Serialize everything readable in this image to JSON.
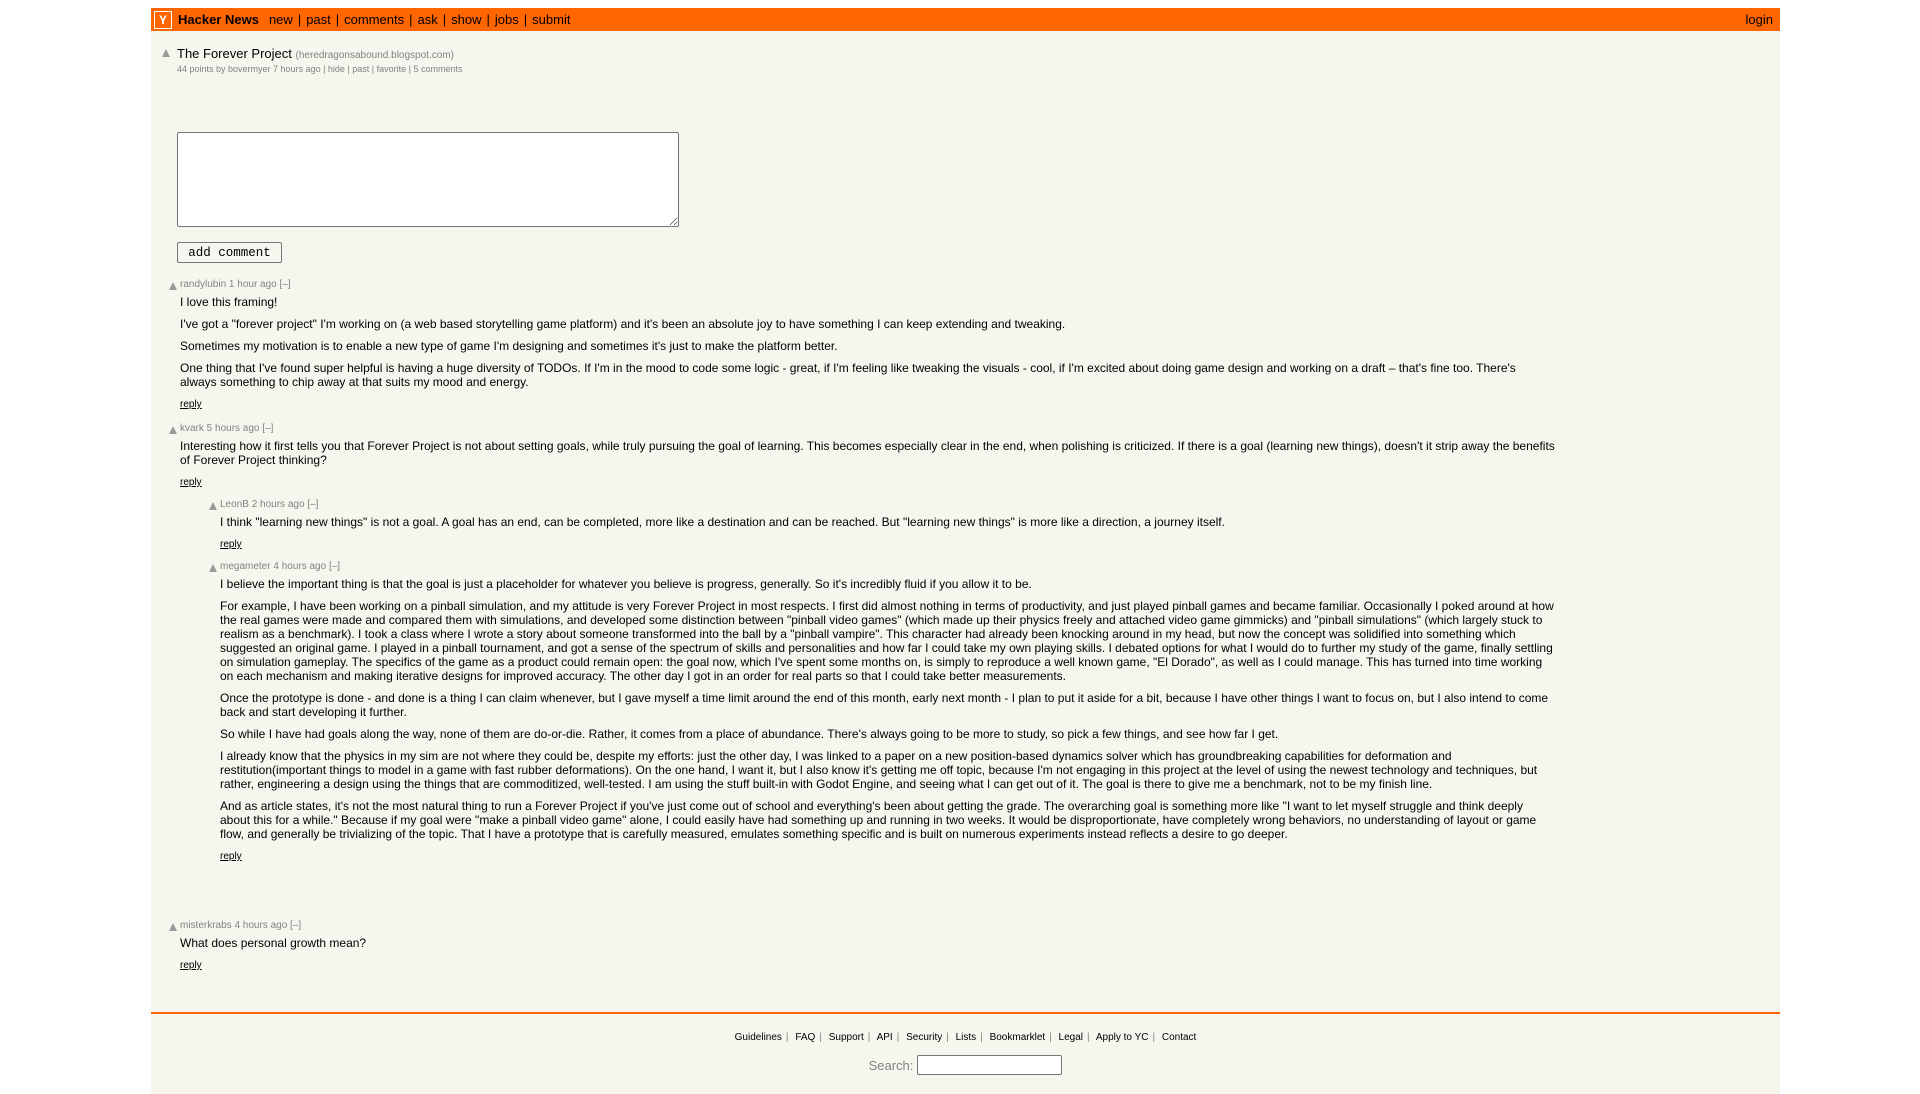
{
  "header": {
    "logo": "Y",
    "site_name": "Hacker News",
    "nav": [
      "new",
      "past",
      "comments",
      "ask",
      "show",
      "jobs",
      "submit"
    ],
    "login": "login"
  },
  "story": {
    "title": "The Forever Project",
    "site": "(heredragonsabound.blogspot.com)",
    "subtext": "44 points by bovermyer 7 hours ago | hide | past | favorite | 5 comments"
  },
  "form": {
    "button": "add comment"
  },
  "comments": [
    {
      "head": "randylubin 1 hour ago [–]",
      "paras": [
        "I love this framing!",
        "I've got a \"forever project\" I'm working on (a web based storytelling game platform) and it's been an absolute joy to have something I can keep extending and tweaking.",
        "Sometimes my motivation is to enable a new type of game I'm designing and sometimes it's just to make the platform better.",
        "One thing that I've found super helpful is having a huge diversity of TODOs. If I'm in the mood to code some logic - great, if I'm feeling like tweaking the visuals - cool, if I'm excited about doing game design and working on a draft – that's fine too. There's always something to chip away at that suits my mood and energy."
      ],
      "reply": "reply"
    },
    {
      "head": "kvark 5 hours ago [–]",
      "paras": [
        "Interesting how it first tells you that Forever Project is not about setting goals, while truly pursuing the goal of learning. This becomes especially clear in the end, when polishing is criticized. If there is a goal (learning new things), doesn't it strip away the benefits of Forever Project thinking?"
      ],
      "reply": "reply"
    },
    {
      "head": "LeonB 2 hours ago [–]",
      "paras": [
        "I think \"learning new things\" is not a goal. A goal has an end, can be completed, more like a destination and can be reached. But \"learning new things\" is more like a direction, a journey itself."
      ],
      "reply": "reply"
    },
    {
      "head": "megameter 4 hours ago [–]",
      "paras": [
        "I believe the important thing is that the goal is just a placeholder for whatever you believe is progress, generally. So it's incredibly fluid if you allow it to be.",
        "For example, I have been working on a pinball simulation, and my attitude is very Forever Project in most respects. I first did almost nothing in terms of productivity, and just played pinball games and became familiar. Occasionally I poked around at how the real games were made and compared them with simulations, and developed some distinction between \"pinball video games\" (which made up their physics freely and attached video game gimmicks) and \"pinball simulations\" (which largely stuck to realism as a benchmark). I took a class where I wrote a story about someone transformed into the ball by a \"pinball vampire\". This character had already been knocking around in my head, but now the concept was solidified into something which suggested an original game. I played in a pinball tournament, and got a sense of the spectrum of skills and personalities and how far I could take my own playing skills. I debated options for what I would do to further my study of the game, finally settling on simulation gameplay. The specifics of the game as a product could remain open: the goal now, which I've spent some months on, is simply to reproduce a well known game, \"El Dorado\", as well as I could manage. This has turned into time working on each mechanism and making iterative designs for improved accuracy. The other day I got in an order for real parts so that I could take better measurements.",
        "Once the prototype is done - and done is a thing I can claim whenever, but I gave myself a time limit around the end of this month, early next month - I plan to put it aside for a bit, because I have other things I want to focus on, but I also intend to come back and start developing it further.",
        "So while I have had goals along the way, none of them are do-or-die. Rather, it comes from a place of abundance. There's always going to be more to study, so pick a few things, and see how far I get.",
        "I already know that the physics in my sim are not where they could be, despite my efforts: just the other day, I was linked to a paper on a new position-based dynamics solver which has groundbreaking capabilities for deformation and restitution(important things to model in a game with fast rubber deformations). On the one hand, I want it, but I also know it's getting me off topic, because I'm not engaging in this project at the level of using the newest technology and techniques, but rather, engineering a design using the things that are commoditized, well-tested. I am using the stuff built-in with Godot Engine, and seeing what I can get out of it. The goal is there to give me a benchmark, not to be my finish line.",
        "And as article states, it's not the most natural thing to run a Forever Project if you've just come out of school and everything's been about getting the grade. The overarching goal is something more like \"I want to let myself struggle and think deeply about this for a while.\" Because if my goal were \"make a pinball video game\" alone, I could easily have had something up and running in two weeks. It would be disproportionate, have completely wrong behaviors, no understanding of layout or game flow, and generally be trivializing of the topic. That I have a prototype that is carefully measured, emulates something specific and is built on numerous experiments instead reflects a desire to go deeper."
      ],
      "reply": "reply"
    },
    {
      "head": "misterkrabs 4 hours ago [–]",
      "paras": [
        "What does personal growth mean?"
      ],
      "reply": "reply"
    }
  ],
  "footer": {
    "links": [
      "Guidelines",
      "FAQ",
      "Support",
      "API",
      "Security",
      "Lists",
      "Bookmarklet",
      "Legal",
      "Apply to YC",
      "Contact"
    ],
    "search_label": "Search:"
  }
}
